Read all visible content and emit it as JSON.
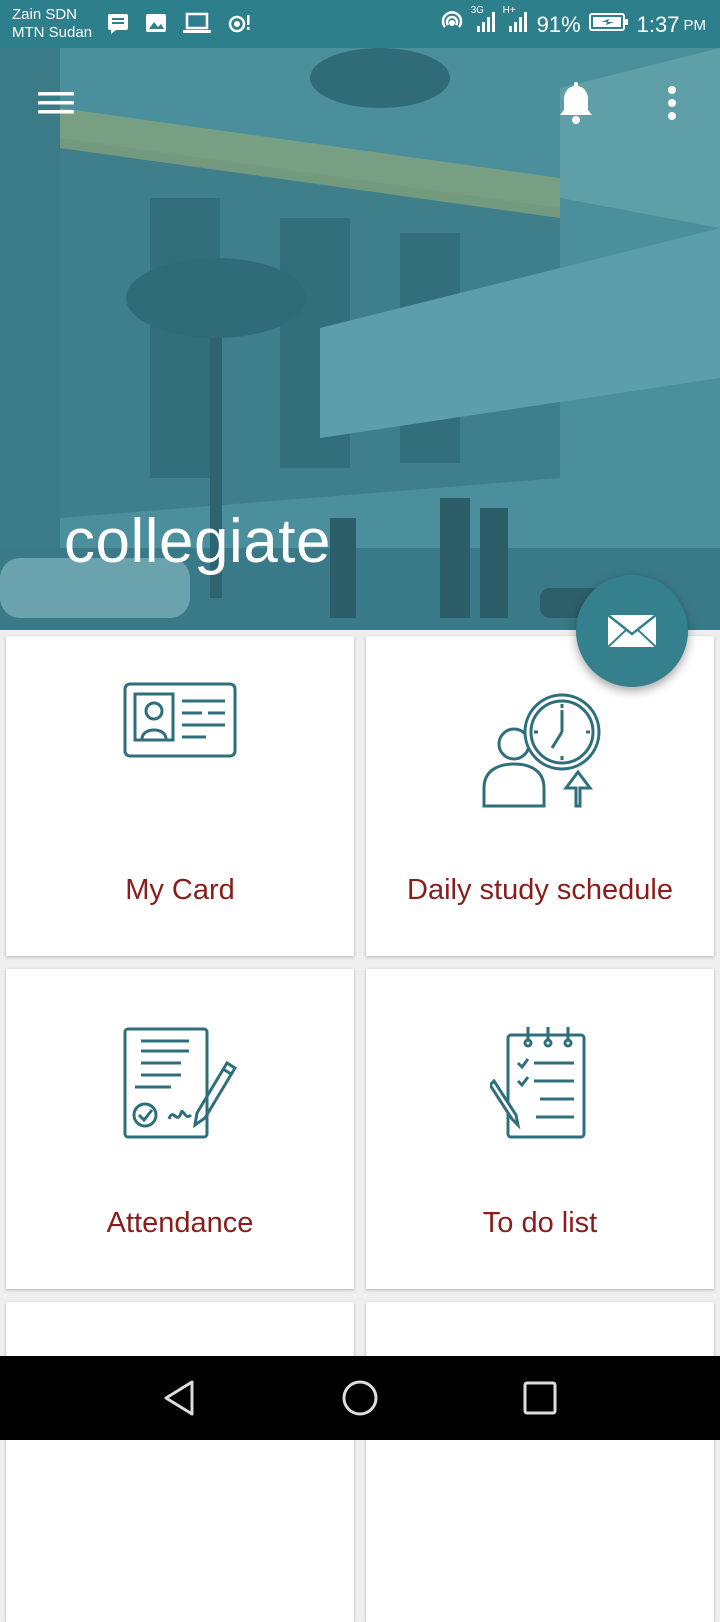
{
  "status_bar": {
    "carrier_1": "Zain SDN",
    "carrier_2": "MTN Sudan",
    "network_1": "3G",
    "network_2": "H+",
    "battery": "91%",
    "time": "1:37",
    "ampm": "PM",
    "icons": [
      "message-icon",
      "image-icon",
      "laptop-icon",
      "hotspot-icon",
      "wifi-calling-icon",
      "signal-icon",
      "battery-icon"
    ]
  },
  "header": {
    "title": "collegiate",
    "background": "college-building-photo",
    "accent_color": "#2e7f8c"
  },
  "fab": {
    "icon": "mail-icon"
  },
  "tiles": [
    {
      "label": "My Card",
      "icon": "id-card-icon"
    },
    {
      "label": "Daily study schedule",
      "icon": "schedule-clock-icon"
    },
    {
      "label": "Attendance",
      "icon": "attendance-sign-icon"
    },
    {
      "label": "To do list",
      "icon": "todo-checklist-icon"
    }
  ],
  "colors": {
    "tile_label": "#8a1c1c",
    "icon_stroke": "#2f6f7c",
    "page_bg": "#eeeeee"
  }
}
